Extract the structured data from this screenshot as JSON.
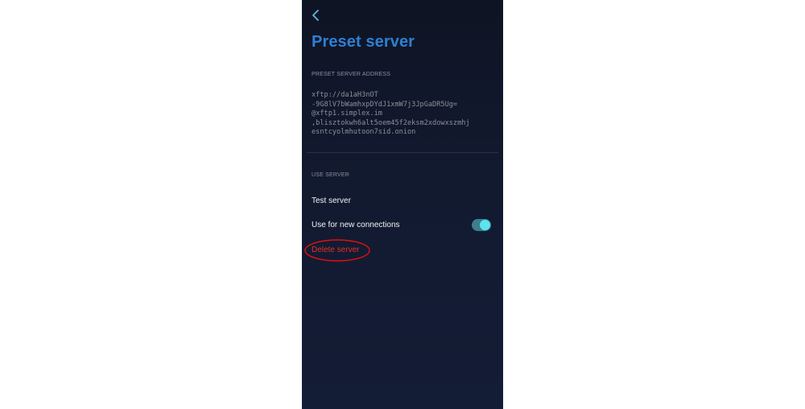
{
  "screen": {
    "title": "Preset server",
    "back_icon": "chevron-left-icon"
  },
  "address_section": {
    "header": "PRESET SERVER ADDRESS",
    "lines": [
      "xftp://da1aH3nOT",
      "-9G8lV7bWamhxpDYdJ1xmW7j3JpGaDR5Ug=",
      "@xftp1.simplex.im",
      ",blisztokwh6alt5oem45f2eksm2xdowxszmhj",
      "esntcyolmhutoon7sid.onion"
    ]
  },
  "use_section": {
    "header": "USE SERVER",
    "test_label": "Test server",
    "use_label": "Use for new connections",
    "use_enabled": true,
    "delete_label": "Delete server"
  },
  "colors": {
    "title": "#2d7fd3",
    "delete": "#e0302a",
    "toggle_track": "#3d7f8f",
    "toggle_knob": "#5fe3f0",
    "annotation": "#e01010"
  }
}
